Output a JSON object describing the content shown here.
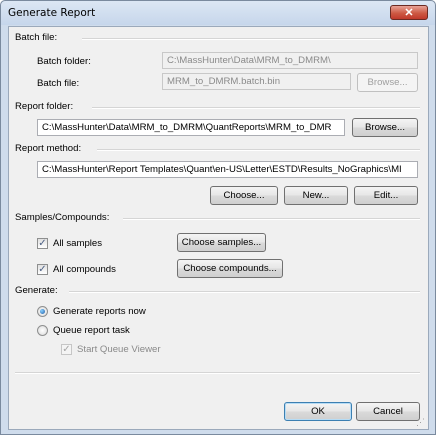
{
  "window": {
    "title": "Generate Report",
    "close_glyph": "✕"
  },
  "batch": {
    "section": "Batch file:",
    "folder_label": "Batch folder:",
    "folder_value": "C:\\MassHunter\\Data\\MRM_to_DMRM\\",
    "file_label": "Batch file:",
    "file_value": "MRM_to_DMRM.batch.bin",
    "browse_label": "Browse..."
  },
  "report_folder": {
    "section": "Report folder:",
    "value": "C:\\MassHunter\\Data\\MRM_to_DMRM\\QuantReports\\MRM_to_DMR",
    "browse_label": "Browse..."
  },
  "report_method": {
    "section": "Report method:",
    "value": "C:\\MassHunter\\Report Templates\\Quant\\en-US\\Letter\\ESTD\\Results_NoGraphics\\MI",
    "choose_label": "Choose...",
    "new_label": "New...",
    "edit_label": "Edit..."
  },
  "samples": {
    "section": "Samples/Compounds:",
    "all_samples_label": "All samples",
    "all_samples_checked": true,
    "choose_samples_label": "Choose samples...",
    "all_compounds_label": "All compounds",
    "all_compounds_checked": true,
    "choose_compounds_label": "Choose compounds..."
  },
  "generate": {
    "section": "Generate:",
    "now_label": "Generate reports now",
    "now_selected": true,
    "queue_label": "Queue report task",
    "viewer_label": "Start Queue Viewer",
    "viewer_checked": true
  },
  "footer": {
    "ok_label": "OK",
    "cancel_label": "Cancel"
  },
  "glyphs": {
    "check": "✓",
    "grip": "⋰"
  }
}
